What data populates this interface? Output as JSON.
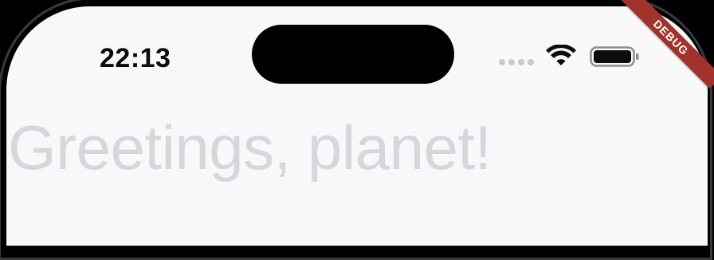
{
  "status_bar": {
    "time": "22:13",
    "signal_icon": "cellular-signal-icon",
    "wifi_icon": "wifi-icon",
    "battery_icon": "battery-icon",
    "battery_level": 1.0
  },
  "debug_banner": {
    "label": "DEBUG",
    "color": "#a0342c"
  },
  "main": {
    "greeting": "Greetings, planet!",
    "greeting_color": "#d6d6db"
  }
}
